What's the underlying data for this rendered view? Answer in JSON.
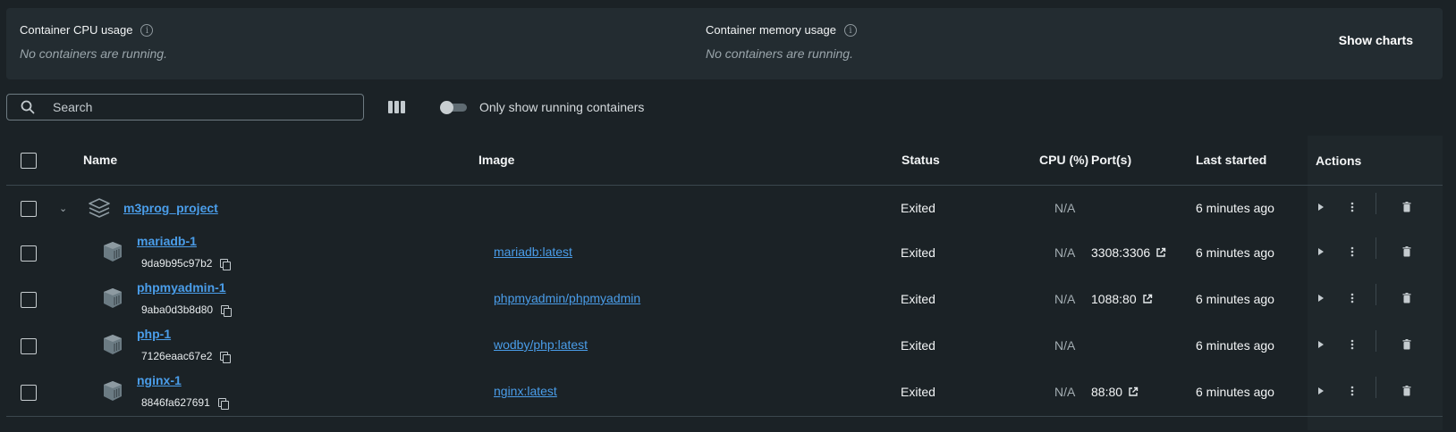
{
  "stats": {
    "cpu_label": "Container CPU usage",
    "cpu_empty": "No containers are running.",
    "mem_label": "Container memory usage",
    "mem_empty": "No containers are running.",
    "show_charts": "Show charts",
    "info_glyph": "i"
  },
  "toolbar": {
    "search_placeholder": "Search",
    "toggle_label": "Only show running containers",
    "toggle_on": false
  },
  "table": {
    "headers": {
      "name": "Name",
      "image": "Image",
      "status": "Status",
      "cpu": "CPU (%)",
      "ports": "Port(s)",
      "last_started": "Last started",
      "actions": "Actions"
    },
    "group": {
      "name": "m3prog_project",
      "status": "Exited",
      "cpu": "N/A",
      "last_started": "6 minutes ago",
      "expanded": true
    },
    "containers": [
      {
        "name": "mariadb-1",
        "id": "9da9b95c97b2",
        "image": "mariadb:latest",
        "status": "Exited",
        "cpu": "N/A",
        "port": "3308:3306",
        "last_started": "6 minutes ago"
      },
      {
        "name": "phpmyadmin-1",
        "id": "9aba0d3b8d80",
        "image": "phpmyadmin/phpmyadmin",
        "status": "Exited",
        "cpu": "N/A",
        "port": "1088:80",
        "last_started": "6 minutes ago"
      },
      {
        "name": "php-1",
        "id": "7126eaac67e2",
        "image": "wodby/php:latest",
        "status": "Exited",
        "cpu": "N/A",
        "port": "",
        "last_started": "6 minutes ago"
      },
      {
        "name": "nginx-1",
        "id": "8846fa627691",
        "image": "nginx:latest",
        "status": "Exited",
        "cpu": "N/A",
        "port": "88:80",
        "last_started": "6 minutes ago"
      }
    ]
  },
  "icons": {
    "search": "search-icon",
    "columns": "columns-icon",
    "group": "stack-icon",
    "container": "container-icon",
    "copy": "copy-icon",
    "external": "external-link-icon",
    "play": "play-icon",
    "more": "more-vertical-icon",
    "delete": "trash-icon"
  },
  "colors": {
    "link": "#4a9de9",
    "background": "#1b2226",
    "panel": "#232c31"
  }
}
